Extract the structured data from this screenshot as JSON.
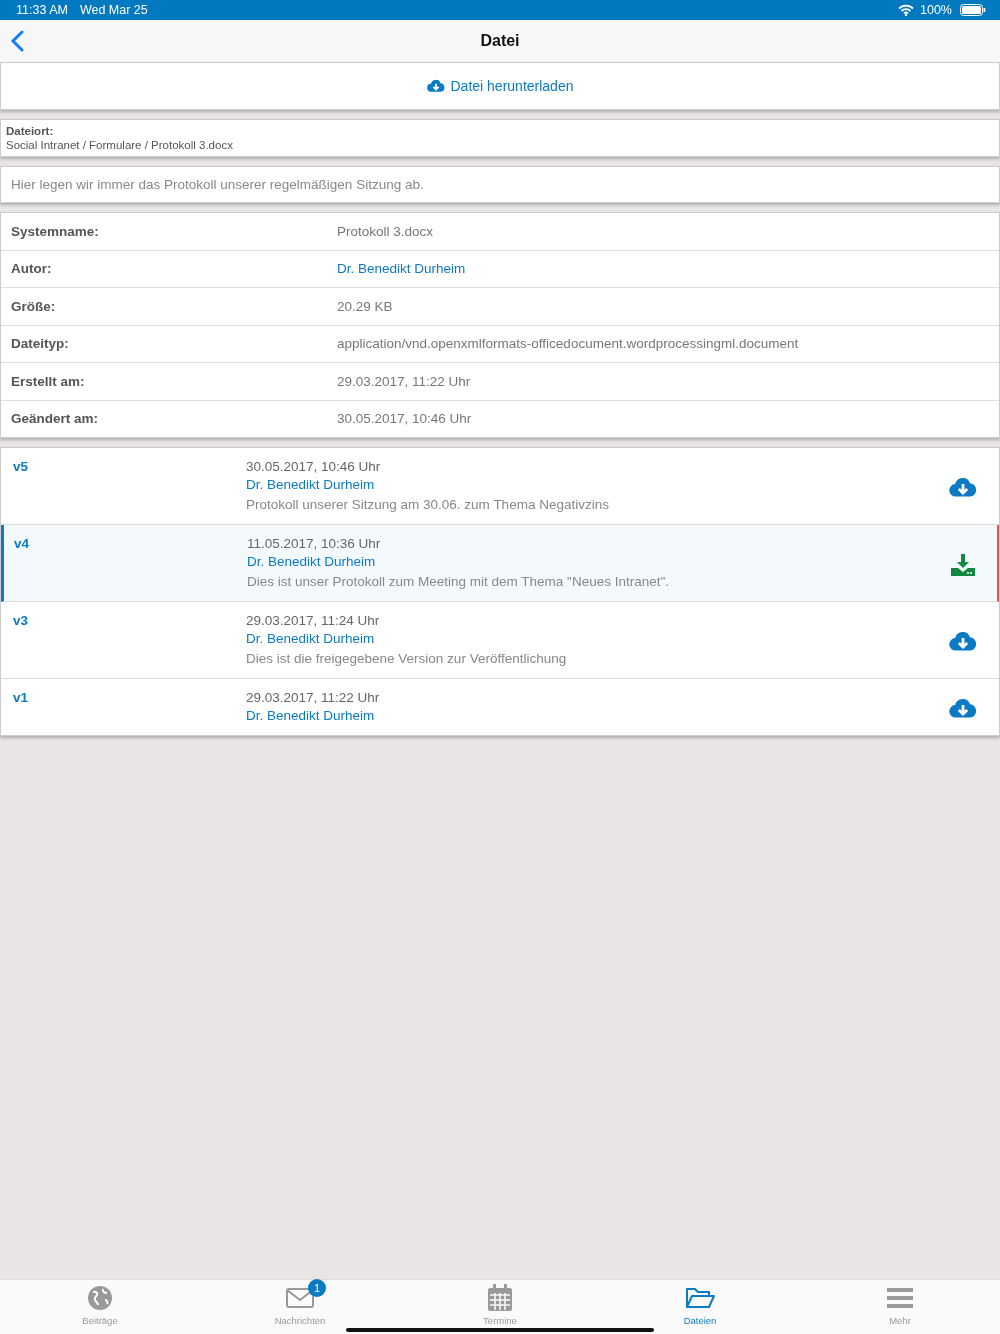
{
  "status_bar": {
    "time": "11:33 AM",
    "date": "Wed Mar 25",
    "battery": "100%"
  },
  "nav": {
    "title": "Datei"
  },
  "download_button": {
    "label": "Datei herunterladen"
  },
  "location": {
    "label": "Dateiort:",
    "path": "Social Intranet / Formulare / Protokoll 3.docx"
  },
  "description": "Hier legen wir immer das Protokoll unserer regelmäßigen Sitzung ab.",
  "properties": [
    {
      "label": "Systemname:",
      "value": "Protokoll 3.docx",
      "kind": "text"
    },
    {
      "label": "Autor:",
      "value": "Dr. Benedikt Durheim",
      "kind": "link"
    },
    {
      "label": "Größe:",
      "value": "20.29 KB",
      "kind": "text"
    },
    {
      "label": "Dateityp:",
      "value": "application/vnd.openxmlformats-officedocument.wordprocessingml.document",
      "kind": "text"
    },
    {
      "label": "Erstellt am:",
      "value": "29.03.2017, 11:22 Uhr",
      "kind": "text"
    },
    {
      "label": "Geändert am:",
      "value": "30.05.2017, 10:46 Uhr",
      "kind": "text"
    }
  ],
  "versions": [
    {
      "version": "v5",
      "date": "30.05.2017, 10:46 Uhr",
      "author": "Dr. Benedikt Durheim",
      "comment": "Protokoll unserer Sitzung am 30.06. zum Thema Negativzins",
      "kind": "cloud",
      "selected": false
    },
    {
      "version": "v4",
      "date": "11.05.2017, 10:36 Uhr",
      "author": "Dr. Benedikt Durheim",
      "comment": "Dies ist unser Protokoll zum Meeting mit dem Thema \"Neues Intranet\".",
      "kind": "downloaded",
      "selected": true
    },
    {
      "version": "v3",
      "date": "29.03.2017, 11:24 Uhr",
      "author": "Dr. Benedikt Durheim",
      "comment": "Dies ist die freigegebene Version zur Veröffentlichung",
      "kind": "cloud",
      "selected": false
    },
    {
      "version": "v1",
      "date": "29.03.2017, 11:22 Uhr",
      "author": "Dr. Benedikt Durheim",
      "kind": "cloud",
      "selected": false
    }
  ],
  "tabs": [
    {
      "label": "Beiträge",
      "kind": "globe",
      "selected": false
    },
    {
      "label": "Nachrichten",
      "kind": "mail",
      "badge": "1",
      "selected": false
    },
    {
      "label": "Termine",
      "kind": "calendar",
      "selected": false
    },
    {
      "label": "Dateien",
      "kind": "folder",
      "selected": true
    },
    {
      "label": "Mehr",
      "kind": "menu",
      "selected": false
    }
  ]
}
